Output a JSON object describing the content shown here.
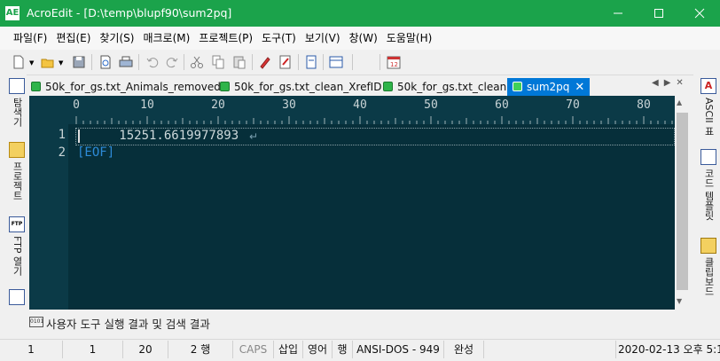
{
  "window": {
    "title": "AcroEdit - [D:\\temp\\blupf90\\sum2pq]",
    "icon_text": "AE",
    "accent": "#1ba34b"
  },
  "menu": [
    "파일(F)",
    "편집(E)",
    "찾기(S)",
    "매크로(M)",
    "프로젝트(P)",
    "도구(T)",
    "보기(V)",
    "창(W)",
    "도움말(H)"
  ],
  "toolbar_icons": [
    "new-file-icon",
    "open-folder-icon",
    "save-icon",
    "print-preview-icon",
    "print-icon",
    "undo-icon",
    "redo-icon",
    "cut-icon",
    "copy-icon",
    "paste-icon",
    "marker-icon",
    "edit-doc-icon",
    "doc-icon",
    "panel-icon",
    "calendar-icon"
  ],
  "left_panel": [
    {
      "label": "탐색기",
      "icon": "explorer-icon"
    },
    {
      "label": "프로젝트",
      "icon": "project-folder-icon"
    },
    {
      "label": "FTP 열기",
      "icon": "ftp-icon"
    }
  ],
  "right_panel": [
    {
      "label": "ASCII 표",
      "icon": "ascii-table-icon"
    },
    {
      "label": "코드 템플릿",
      "icon": "code-template-icon"
    },
    {
      "label": "클립보드",
      "icon": "clipboard-icon"
    }
  ],
  "tabs": [
    {
      "label": "50k_for_gs.txt_Animals_removed",
      "active": false
    },
    {
      "label": "50k_for_gs.txt_clean_XrefID",
      "active": false
    },
    {
      "label": "50k_for_gs.txt_clean",
      "active": false
    },
    {
      "label": "sum2pq",
      "active": true
    }
  ],
  "editor": {
    "ruler_numbers": [
      "0",
      "10",
      "20",
      "30",
      "40",
      "50",
      "60",
      "70",
      "80"
    ],
    "line_numbers": [
      "1",
      "2"
    ],
    "line1": "   15251.6619977893",
    "eof": "[EOF]",
    "background": "#062f3a"
  },
  "output_panel": {
    "label": "사용자 도구 실행 결과 및 검색 결과"
  },
  "status": {
    "line": "1",
    "column": "1",
    "chars": "20",
    "lines": "2 행",
    "caps": "CAPS",
    "insert": "삽입",
    "lang": "영어",
    "mode": "행",
    "encoding": "ANSI-DOS - 949",
    "state": "완성",
    "datetime": "2020-02-13 오후 5:1"
  }
}
